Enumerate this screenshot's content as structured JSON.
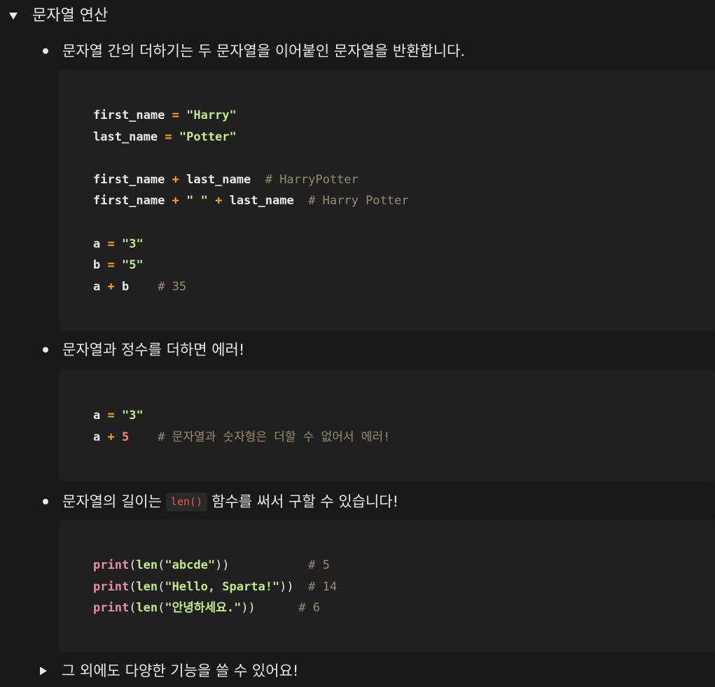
{
  "toggle_main": {
    "title": "문자열 연산",
    "icon": "triangle-down-icon"
  },
  "bullets": [
    {
      "text": "문자열 간의 더하기는 두 문자열을 이어붙인 문자열을 반환합니다."
    },
    {
      "text": "문자열과 정수를 더하면 에러!"
    },
    {
      "text_before": "문자열의 길이는",
      "code": "len()",
      "text_after": "함수를 써서 구할 수 있습니다!"
    }
  ],
  "code_blocks": [
    {
      "lines": [
        [
          [
            "var",
            "first_name"
          ],
          [
            "plain",
            " "
          ],
          [
            "op",
            "="
          ],
          [
            "plain",
            " "
          ],
          [
            "str",
            "\"Harry\""
          ]
        ],
        [
          [
            "var",
            "last_name"
          ],
          [
            "plain",
            " "
          ],
          [
            "op",
            "="
          ],
          [
            "plain",
            " "
          ],
          [
            "str",
            "\"Potter\""
          ]
        ],
        [],
        [
          [
            "var",
            "first_name"
          ],
          [
            "plain",
            " "
          ],
          [
            "op",
            "+"
          ],
          [
            "plain",
            " "
          ],
          [
            "var",
            "last_name"
          ],
          [
            "plain",
            "  "
          ],
          [
            "cmt",
            "# HarryPotter"
          ]
        ],
        [
          [
            "var",
            "first_name"
          ],
          [
            "plain",
            " "
          ],
          [
            "op",
            "+"
          ],
          [
            "plain",
            " "
          ],
          [
            "str",
            "\" \""
          ],
          [
            "plain",
            " "
          ],
          [
            "op",
            "+"
          ],
          [
            "plain",
            " "
          ],
          [
            "var",
            "last_name"
          ],
          [
            "plain",
            "  "
          ],
          [
            "cmt",
            "# Harry Potter"
          ]
        ],
        [],
        [
          [
            "var",
            "a"
          ],
          [
            "plain",
            " "
          ],
          [
            "op",
            "="
          ],
          [
            "plain",
            " "
          ],
          [
            "str",
            "\"3\""
          ]
        ],
        [
          [
            "var",
            "b"
          ],
          [
            "plain",
            " "
          ],
          [
            "op",
            "="
          ],
          [
            "plain",
            " "
          ],
          [
            "str",
            "\"5\""
          ]
        ],
        [
          [
            "var",
            "a"
          ],
          [
            "plain",
            " "
          ],
          [
            "op",
            "+"
          ],
          [
            "plain",
            " "
          ],
          [
            "var",
            "b"
          ],
          [
            "plain",
            "    "
          ],
          [
            "cmt",
            "# 35"
          ]
        ]
      ]
    },
    {
      "lines": [
        [
          [
            "var",
            "a"
          ],
          [
            "plain",
            " "
          ],
          [
            "op",
            "="
          ],
          [
            "plain",
            " "
          ],
          [
            "str",
            "\"3\""
          ]
        ],
        [
          [
            "var",
            "a"
          ],
          [
            "plain",
            " "
          ],
          [
            "op",
            "+"
          ],
          [
            "plain",
            " "
          ],
          [
            "num",
            "5"
          ],
          [
            "plain",
            "    "
          ],
          [
            "cmt",
            "# 문자열과 숫자형은 더할 수 없어서 에러!"
          ]
        ]
      ]
    },
    {
      "lines": [
        [
          [
            "fn",
            "print"
          ],
          [
            "punc",
            "("
          ],
          [
            "builtin",
            "len"
          ],
          [
            "punc",
            "("
          ],
          [
            "pstr",
            "\"abcde\""
          ],
          [
            "punc",
            "))"
          ],
          [
            "plain",
            "           "
          ],
          [
            "cmt",
            "# 5"
          ]
        ],
        [
          [
            "fn",
            "print"
          ],
          [
            "punc",
            "("
          ],
          [
            "builtin",
            "len"
          ],
          [
            "punc",
            "("
          ],
          [
            "pstr",
            "\"Hello, Sparta!\""
          ],
          [
            "punc",
            "))"
          ],
          [
            "plain",
            "  "
          ],
          [
            "cmt",
            "# 14"
          ]
        ],
        [
          [
            "fn",
            "print"
          ],
          [
            "punc",
            "("
          ],
          [
            "builtin",
            "len"
          ],
          [
            "punc",
            "("
          ],
          [
            "pstr",
            "\"안녕하세요.\""
          ],
          [
            "punc",
            "))"
          ],
          [
            "plain",
            "      "
          ],
          [
            "cmt",
            "# 6"
          ]
        ]
      ]
    }
  ],
  "toggle_more": {
    "title": "그 외에도 다양한 기능을 쓸 수 있어요!",
    "icon": "triangle-right-icon"
  },
  "colors": {
    "background": "#191919",
    "code_background": "#202020",
    "text": "#e9e9e7",
    "operator": "#f5a623",
    "string": "#c3e88d",
    "comment": "#9a8a70",
    "number": "#f78c6c",
    "function": "#e58fa3",
    "inline_code": "#eb5757"
  }
}
